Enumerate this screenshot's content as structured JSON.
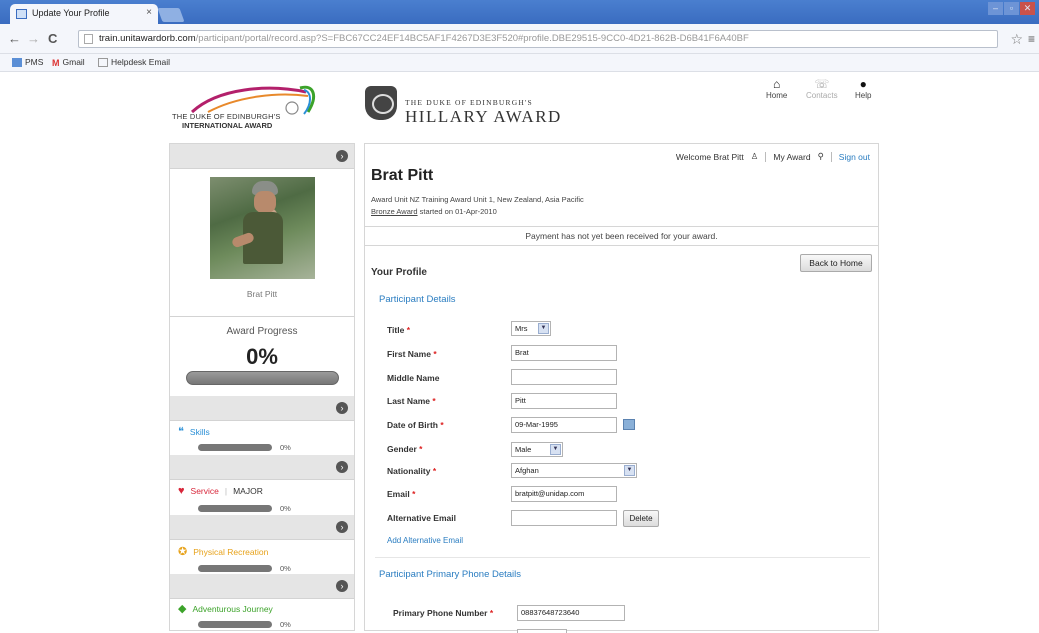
{
  "browser": {
    "tab_title": "Update Your Profile",
    "tab_close": "×",
    "url_host": "train.unitawardorb.com",
    "url_rest": "/participant/portal/record.asp?S=FBC67CC24EF14BC5AF1F4267D3E3F520#profile.DBE29515-9CC0-4D21-862B-D6B41F6A40BF",
    "bookmarks": [
      "PMS",
      "Gmail",
      "Helpdesk Email"
    ],
    "icons": [
      "back-arrow-icon",
      "forward-arrow-icon",
      "reload-icon",
      "star-icon",
      "wrench-icon"
    ]
  },
  "header": {
    "intl_logo_line1": "THE DUKE OF EDINBURGH'S",
    "intl_logo_line2": "INTERNATIONAL AWARD",
    "hillary_line1": "THE DUKE OF EDINBURGH'S",
    "hillary_line2": "HILLARY AWARD",
    "nav": {
      "home": "Home",
      "contacts": "Contacts",
      "help": "Help"
    }
  },
  "sidebar": {
    "participant_name": "Brat Pitt",
    "award_progress_label": "Award Progress",
    "award_progress_value": "0%",
    "award_progress_fraction": 0,
    "sections": [
      {
        "label": "Skills",
        "pct": "0%",
        "color": "#2a8fd6",
        "icon": "chat-bubble-icon"
      },
      {
        "label": "Service",
        "extra": "MAJOR",
        "pct": "0%",
        "color": "#d8263a",
        "icon": "hands-icon"
      },
      {
        "label": "Physical Recreation",
        "pct": "0%",
        "color": "#e7a21a",
        "icon": "runner-icon"
      },
      {
        "label": "Adventurous Journey",
        "pct": "0%",
        "color": "#3ca32a",
        "icon": "compass-icon"
      }
    ]
  },
  "main": {
    "welcome": "Welcome Brat Pitt",
    "my_award": "My Award",
    "sign_out": "Sign out",
    "user_name": "Brat Pitt",
    "award_unit": "Award Unit NZ Training Award Unit 1, New Zealand, Asia Pacific",
    "award_level": "Bronze Award",
    "award_started": " started on 01-Apr-2010",
    "payment_notice": "Payment has not yet been received for your award.",
    "your_profile": "Your Profile",
    "back_to_home": "Back to Home",
    "participant_details": "Participant Details",
    "fields": {
      "title_label": "Title",
      "title_value": "Mrs",
      "first_name_label": "First Name",
      "first_name_value": "Brat",
      "middle_name_label": "Middle Name",
      "middle_name_value": "",
      "last_name_label": "Last Name",
      "last_name_value": "Pitt",
      "dob_label": "Date of Birth",
      "dob_value": "09-Mar-1995",
      "gender_label": "Gender",
      "gender_value": "Male",
      "nationality_label": "Nationality",
      "nationality_value": "Afghan",
      "email_label": "Email",
      "email_value": "bratpitt@unidap.com",
      "alt_email_label": "Alternative Email",
      "alt_email_value": ""
    },
    "delete": "Delete",
    "add_alt_email": "Add Alternative Email",
    "phone_section": "Participant Primary Phone Details",
    "primary_phone_label": "Primary Phone Number",
    "primary_phone_value": "08837648723640",
    "required_mark": "*"
  }
}
